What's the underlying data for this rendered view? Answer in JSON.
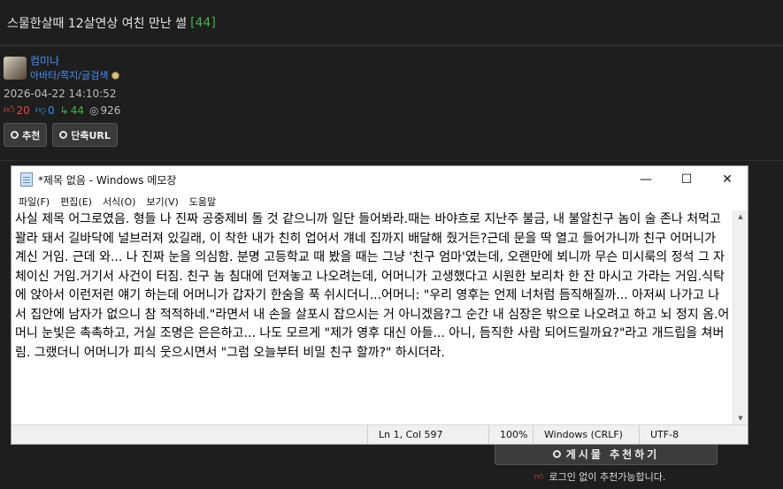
{
  "post": {
    "title": "스물한살때 12살연상 여친 만난 썰",
    "comment_count": "[44]",
    "author": "컴미나",
    "author_links": "아바타/쪽지/글검색",
    "date": "2026-04-22 14:10:52",
    "stats": {
      "upvotes": "20",
      "downvotes": "0",
      "shares": "44",
      "views": "926"
    },
    "buttons": {
      "recommend": "추천",
      "short_url": "단축URL"
    }
  },
  "footer": {
    "recommend_label": "게시물 추천하기",
    "login_note": "로그인 없이 추천가능합니다."
  },
  "notepad": {
    "window_title": "*제목 없음 - Windows 메모장",
    "controls": {
      "minimize": "—",
      "maximize": "☐",
      "close": "✕"
    },
    "menu": [
      "파일(F)",
      "편집(E)",
      "서식(O)",
      "보기(V)",
      "도움말"
    ],
    "content": "사실 제목 어그로였음. 형들 나 진짜 공중제비 돌 것 같으니까 일단 들어봐라.때는 바야흐로 지난주 불금, 내 불알친구 놈이 술 존나 처먹고 꽐라 돼서 길바닥에 널브러져 있길래, 이 착한 내가 친히 업어서 걔네 집까지 배달해 줬거든?근데 문을 딱 열고 들어가니까 친구 어머니가 계신 거임. 근데 와... 나 진짜 눈을 의심함. 분명 고등학교 때 봤을 때는 그냥 '친구 엄마'였는데, 오랜만에 뵈니까 무슨 미시룩의 정석 그 자체이신 거임.거기서 사건이 터짐. 친구 놈 침대에 던져놓고 나오려는데, 어머니가 고생했다고 시원한 보리차 한 잔 마시고 가라는 거임.식탁에 앉아서 이런저런 얘기 하는데 어머니가 갑자기 한숨을 푹 쉬시더니...어머니: \"우리 영후는 언제 너처럼 듬직해질까... 아저씨 나가고 나서 집안에 남자가 없으니 참 적적하네.\"라면서 내 손을 살포시 잡으시는 거 아니겠음?그 순간 내 심장은 밖으로 나오려고 하고 뇌 정지 옴.어머니 눈빛은 촉촉하고, 거실 조명은 은은하고... 나도 모르게 \"제가 영후 대신 아들... 아니, 듬직한 사람 되어드릴까요?\"라고 개드립을 쳐버림. 그랬더니 어머니가 피식 웃으시면서 \"그럼 오늘부터 비밀 친구 할까?\" 하시더라.",
    "status": {
      "position": "Ln 1, Col 597",
      "zoom": "100%",
      "line_ending": "Windows (CRLF)",
      "encoding": "UTF-8"
    }
  }
}
